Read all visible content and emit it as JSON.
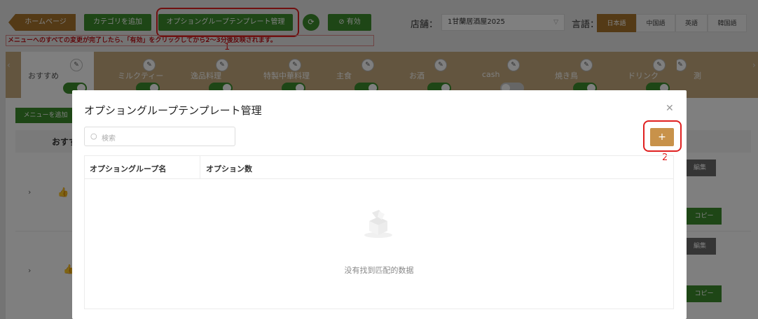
{
  "toolbar": {
    "home": "ホームページ",
    "add_category": "カテゴリを追加",
    "option_template": "オプショングループテンプレート管理",
    "refresh_icon": "refresh-icon",
    "enable": "有効",
    "store_label": "店舗：",
    "store_value": "1甘蘭居酒屋2025",
    "lang_label": "言語：",
    "languages": [
      "日本語",
      "中国語",
      "英語",
      "韓国語"
    ],
    "active_language": "日本語"
  },
  "notice": "メニューへのすべての変更が完了したら、「有効」をクリックしてから2〜3分後反映されます。",
  "annotations": {
    "step1": "1",
    "step2": "2"
  },
  "categories": [
    {
      "label": "おすすめ",
      "enabled": true
    },
    {
      "label": "ミルクティー",
      "enabled": true
    },
    {
      "label": "逸品料理",
      "enabled": true
    },
    {
      "label": "特製中華料理",
      "enabled": true
    },
    {
      "label": "主食",
      "enabled": true
    },
    {
      "label": "お酒",
      "enabled": true
    },
    {
      "label": "cash",
      "enabled": false
    },
    {
      "label": "焼き鳥",
      "enabled": true
    },
    {
      "label": "ドリンク",
      "enabled": true
    },
    {
      "label": "測",
      "enabled": true
    }
  ],
  "background": {
    "add_menu": "メニューを追加",
    "table_header": "おすす",
    "edit": "編集",
    "copy": "コピー"
  },
  "modal": {
    "title": "オプショングループテンプレート管理",
    "search_placeholder": "検索",
    "columns": [
      "オプショングループ名",
      "オプション数"
    ],
    "empty_text": "没有找到匹配的数据"
  },
  "colors": {
    "brand_gold": "#a8752d",
    "green": "#3d8c2d",
    "annotation_red": "#e02020",
    "add_button": "#c8924a"
  }
}
